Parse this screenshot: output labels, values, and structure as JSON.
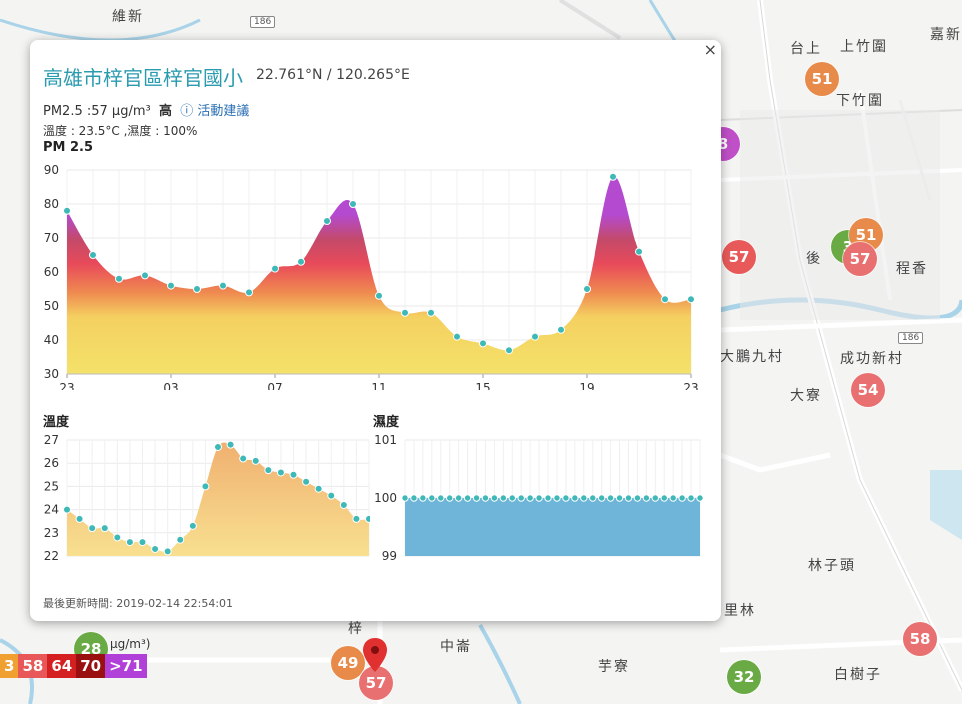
{
  "map": {
    "places": [
      {
        "name": "維新",
        "x": 112,
        "y": 6
      },
      {
        "name": "台上",
        "x": 790,
        "y": 38
      },
      {
        "name": "上竹圍",
        "x": 840,
        "y": 36
      },
      {
        "name": "嘉新",
        "x": 930,
        "y": 24
      },
      {
        "name": "下竹圍",
        "x": 836,
        "y": 90
      },
      {
        "name": "後",
        "x": 806,
        "y": 248
      },
      {
        "name": "程香",
        "x": 896,
        "y": 258
      },
      {
        "name": "大鵬九村",
        "x": 720,
        "y": 346
      },
      {
        "name": "成功新村",
        "x": 840,
        "y": 348
      },
      {
        "name": "大寮",
        "x": 790,
        "y": 385
      },
      {
        "name": "林子頭",
        "x": 808,
        "y": 555
      },
      {
        "name": "里林",
        "x": 724,
        "y": 600
      },
      {
        "name": "中崙",
        "x": 440,
        "y": 636
      },
      {
        "name": "芋寮",
        "x": 598,
        "y": 656
      },
      {
        "name": "白樹子",
        "x": 834,
        "y": 664
      },
      {
        "name": "梓",
        "x": 348,
        "y": 618
      }
    ],
    "badges": [
      {
        "text": "186",
        "x": 250,
        "y": 16
      },
      {
        "text": "186",
        "x": 898,
        "y": 332
      }
    ],
    "markers": [
      {
        "value": "51",
        "x": 805,
        "y": 62,
        "color": "#e88a4a"
      },
      {
        "value": "8",
        "x": 706,
        "y": 127,
        "color": "#c050c8"
      },
      {
        "value": "57",
        "x": 722,
        "y": 240,
        "color": "#e85a5a"
      },
      {
        "value": "3",
        "x": 831,
        "y": 230,
        "color": "#6aaa44"
      },
      {
        "value": "51",
        "x": 849,
        "y": 218,
        "color": "#e88a4a"
      },
      {
        "value": "57",
        "x": 843,
        "y": 242,
        "color": "#e87070"
      },
      {
        "value": "54",
        "x": 851,
        "y": 373,
        "color": "#e87070"
      },
      {
        "value": "58",
        "x": 903,
        "y": 622,
        "color": "#e87070"
      },
      {
        "value": "32",
        "x": 727,
        "y": 660,
        "color": "#6aaa44"
      },
      {
        "value": "49",
        "x": 331,
        "y": 646,
        "color": "#e88a4a"
      },
      {
        "value": "57",
        "x": 359,
        "y": 666,
        "color": "#e87070"
      },
      {
        "value": "28",
        "x": 74,
        "y": 632,
        "color": "#6aaa44"
      }
    ],
    "legend_unit": "µg/m³)",
    "legend": [
      {
        "label": "3",
        "color": "#f0a030"
      },
      {
        "label": "58",
        "color": "#e85858"
      },
      {
        "label": "64",
        "color": "#d42020"
      },
      {
        "label": "70",
        "color": "#9a1010"
      },
      {
        "label": ">71",
        "color": "#b040d8"
      }
    ]
  },
  "popup": {
    "close_label": "×",
    "title": "高雄市梓官區梓官國小",
    "coords": "22.761°N / 120.265°E",
    "pm_text": "PM2.5 :57 μg/m³",
    "pm_level": "高",
    "advice_icon": "info-circle-icon",
    "advice_link": "活動建議",
    "weather": "溫度 : 23.5°C ,濕度 : 100%",
    "pm_chart_title": "PM 2.5",
    "temp_chart_title": "溫度",
    "humidity_chart_title": "濕度",
    "updated": "最後更新時間: 2019-02-14 22:54:01"
  },
  "chart_data": [
    {
      "type": "area",
      "title": "PM 2.5",
      "x_tick_labels": [
        "23",
        "03",
        "07",
        "11",
        "15",
        "19",
        "23"
      ],
      "ylim": [
        30,
        90
      ],
      "y_ticks": [
        30,
        40,
        50,
        60,
        70,
        80,
        90
      ],
      "values": [
        78,
        65,
        58,
        59,
        56,
        55,
        56,
        54,
        61,
        63,
        75,
        80,
        53,
        48,
        48,
        41,
        39,
        37,
        41,
        43,
        55,
        88,
        66,
        52,
        52
      ],
      "grid": true
    },
    {
      "type": "area",
      "title": "溫度",
      "ylim": [
        22,
        27
      ],
      "y_ticks": [
        22,
        23,
        24,
        25,
        26,
        27
      ],
      "values": [
        24.0,
        23.6,
        23.2,
        23.2,
        22.8,
        22.6,
        22.6,
        22.3,
        22.2,
        22.7,
        23.3,
        25.0,
        26.7,
        26.8,
        26.2,
        26.1,
        25.7,
        25.6,
        25.5,
        25.2,
        24.9,
        24.6,
        24.2,
        23.6,
        23.6
      ],
      "grid": true
    },
    {
      "type": "area",
      "title": "濕度",
      "ylim": [
        99,
        101
      ],
      "y_ticks": [
        99,
        100,
        101
      ],
      "values": [
        100,
        100,
        100,
        100,
        100,
        100,
        100,
        100,
        100,
        100,
        100,
        100,
        100,
        100,
        100,
        100,
        100,
        100,
        100,
        100,
        100,
        100,
        100,
        100,
        100,
        100,
        100,
        100,
        100,
        100,
        100,
        100,
        100,
        100
      ],
      "grid": true
    }
  ]
}
